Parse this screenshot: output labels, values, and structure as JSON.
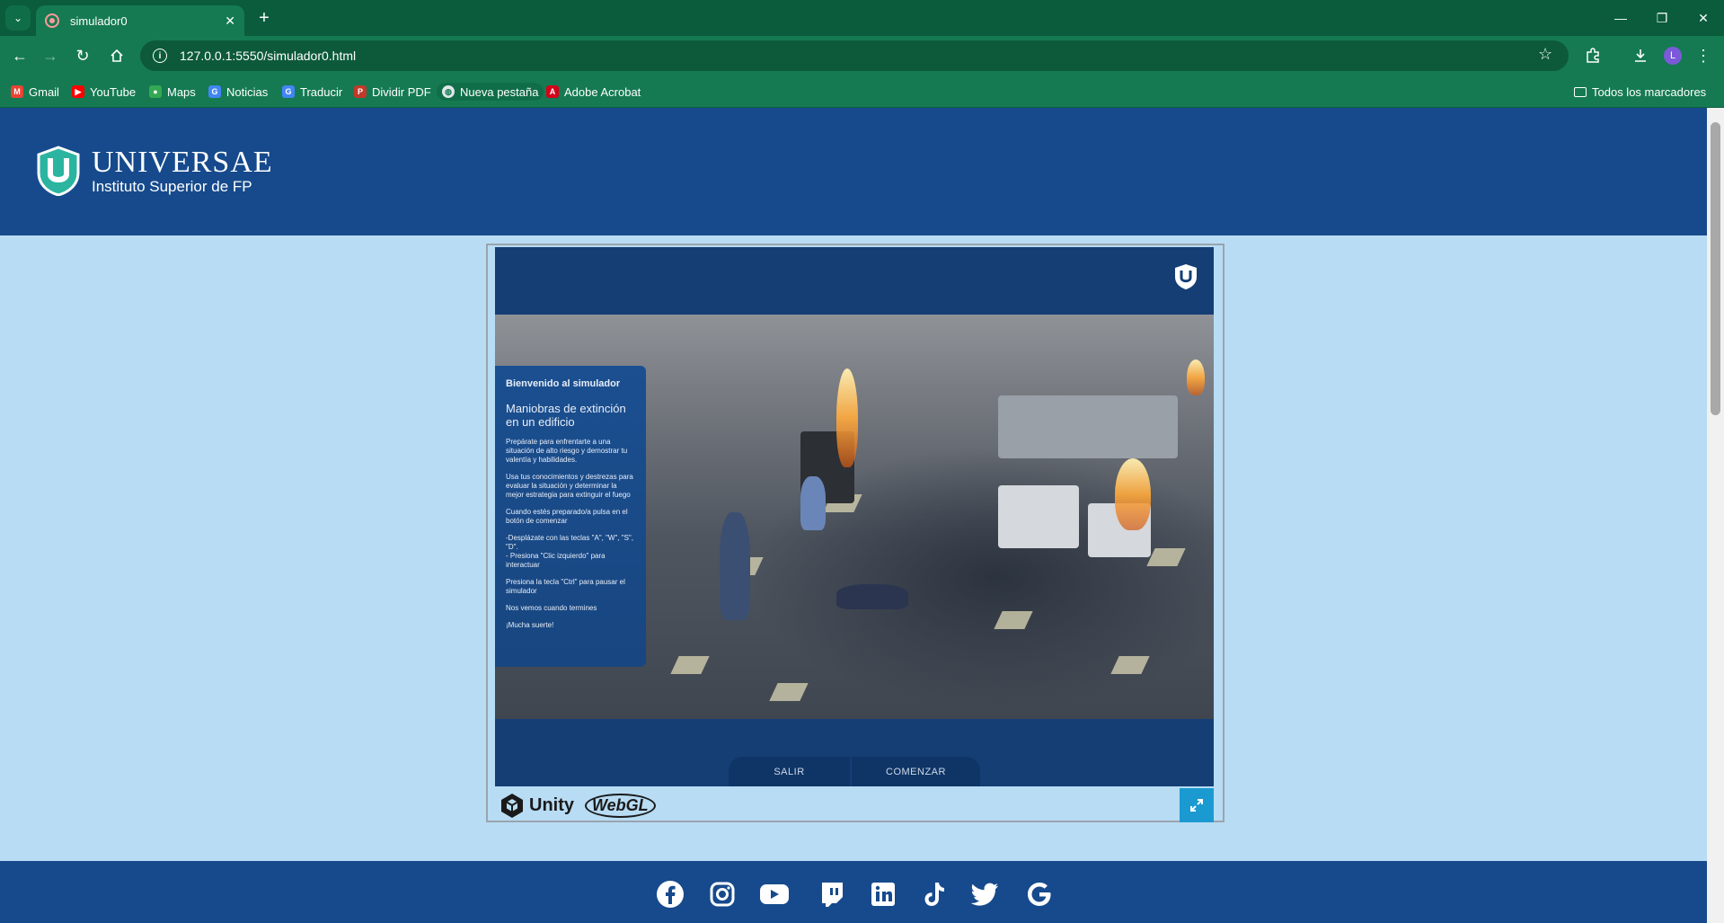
{
  "browser": {
    "tab_title": "simulador0",
    "url": "127.0.0.1:5550/simulador0.html",
    "avatar_letter": "L",
    "bookmarks": [
      {
        "label": "Gmail",
        "icon": "gmail-icon",
        "color": "#ea4335"
      },
      {
        "label": "YouTube",
        "icon": "youtube-icon",
        "color": "#ff0000"
      },
      {
        "label": "Maps",
        "icon": "maps-icon",
        "color": "#34a853"
      },
      {
        "label": "Noticias",
        "icon": "news-icon",
        "color": "#4285f4"
      },
      {
        "label": "Traducir",
        "icon": "translate-icon",
        "color": "#4285f4"
      },
      {
        "label": "Dividir PDF",
        "icon": "pdf-icon",
        "color": "#c0392b"
      },
      {
        "label": "Nueva pestaña",
        "icon": "globe-icon",
        "color": "#dfe6e9"
      },
      {
        "label": "Adobe Acrobat",
        "icon": "acrobat-icon",
        "color": "#d4001a"
      }
    ],
    "all_bookmarks": "Todos los marcadores"
  },
  "header": {
    "brand": "UNIVERSAE",
    "subtitle": "Instituto Superior de FP"
  },
  "simulator": {
    "panel_title": "Bienvenido al simulador",
    "panel_heading": "Maniobras de extinción en un edificio",
    "paragraphs": [
      "Prepárate para enfrentarte a una situación de alto riesgo y demostrar tu valentía y habilidades.",
      "Usa tus conocimientos y destrezas para evaluar la situación y determinar la mejor estrategia para extinguir el fuego",
      "Cuando estés preparado/a pulsa en el botón de comenzar",
      "-Desplázate con las teclas \"A\", \"W\", \"S\", \"D\".\n- Presiona \"Clic izquierdo\" para interactuar",
      "Presiona la tecla \"Ctrl\" para pausar el simulador",
      "Nos vemos cuando termines",
      "¡Mucha suerte!"
    ],
    "exit_label": "SALIR",
    "start_label": "COMENZAR"
  },
  "unity_footer": {
    "unity_label": "Unity",
    "webgl_label": "WebGL"
  },
  "social_icons": [
    "facebook-icon",
    "instagram-icon",
    "youtube-icon",
    "twitch-icon",
    "linkedin-icon",
    "tiktok-icon",
    "twitter-icon",
    "google-icon"
  ],
  "colors": {
    "browser_green": "#157a52",
    "header_blue": "#164a8c",
    "page_bg": "#b8dcf4",
    "fullscreen_blue": "#1b9ad1"
  }
}
